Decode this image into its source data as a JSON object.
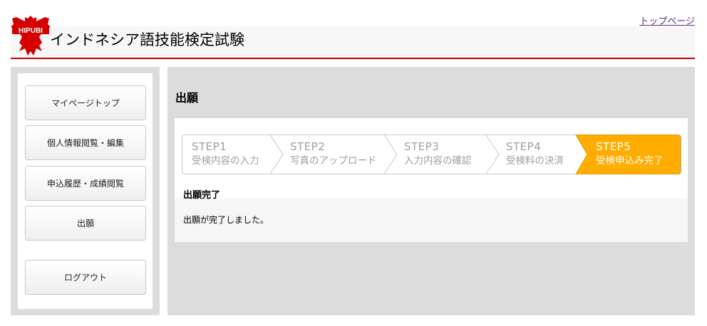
{
  "header": {
    "site_title": "インドネシア語技能検定試験",
    "logo_text": "HIPUBI",
    "top_link": "トップページ"
  },
  "sidebar": {
    "items": [
      {
        "label": "マイページトップ"
      },
      {
        "label": "個人情報閲覧・編集"
      },
      {
        "label": "申込履歴・成績閲覧"
      },
      {
        "label": "出願"
      },
      {
        "label": "ログアウト"
      }
    ]
  },
  "main": {
    "title": "出願",
    "steps": [
      {
        "num": "STEP1",
        "label": "受検内容の入力",
        "active": false
      },
      {
        "num": "STEP2",
        "label": "写真のアップロード",
        "active": false
      },
      {
        "num": "STEP3",
        "label": "入力内容の確認",
        "active": false
      },
      {
        "num": "STEP4",
        "label": "受検料の決済",
        "active": false
      },
      {
        "num": "STEP5",
        "label": "受検申込み完了",
        "active": true
      }
    ],
    "complete_heading": "出願完了",
    "complete_message": "出願が完了しました。"
  },
  "colors": {
    "accent_red": "#c80000",
    "step_active": "#ffad00",
    "link": "#5a2d82"
  }
}
